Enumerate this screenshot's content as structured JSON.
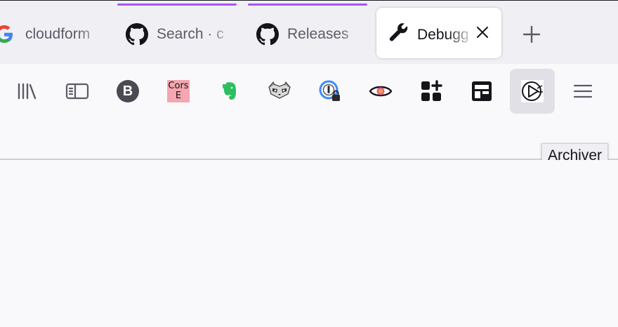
{
  "tabs": [
    {
      "title": "cloudform",
      "icon": "google-icon",
      "attention": false,
      "selected": false
    },
    {
      "title": "Search · c",
      "icon": "github-icon",
      "attention": true,
      "selected": false
    },
    {
      "title": "Releases",
      "icon": "github-icon",
      "attention": true,
      "selected": false
    },
    {
      "title": "Debugg",
      "icon": "wrench-icon",
      "attention": false,
      "selected": true
    }
  ],
  "toolbar": {
    "items": [
      {
        "name": "library-icon"
      },
      {
        "name": "sidebar-icon"
      },
      {
        "name": "b-extension-icon",
        "text": "B"
      },
      {
        "name": "cors-extension-icon",
        "text": "Cors\nE"
      },
      {
        "name": "evernote-icon"
      },
      {
        "name": "raccoon-extension-icon"
      },
      {
        "name": "password-lock-extension-icon"
      },
      {
        "name": "eye-extension-icon"
      },
      {
        "name": "apps-grid-icon"
      },
      {
        "name": "dashboard-extension-icon"
      },
      {
        "name": "archiver-extension-icon",
        "hovered": true
      },
      {
        "name": "hamburger-menu-icon"
      }
    ]
  },
  "tooltip": {
    "text": "Archiver"
  },
  "colors": {
    "attention": "#a855f7",
    "toolbar_bg": "#f9f9fb",
    "tabstrip_bg": "#f0f0f4",
    "evernote": "#2dbe60"
  }
}
